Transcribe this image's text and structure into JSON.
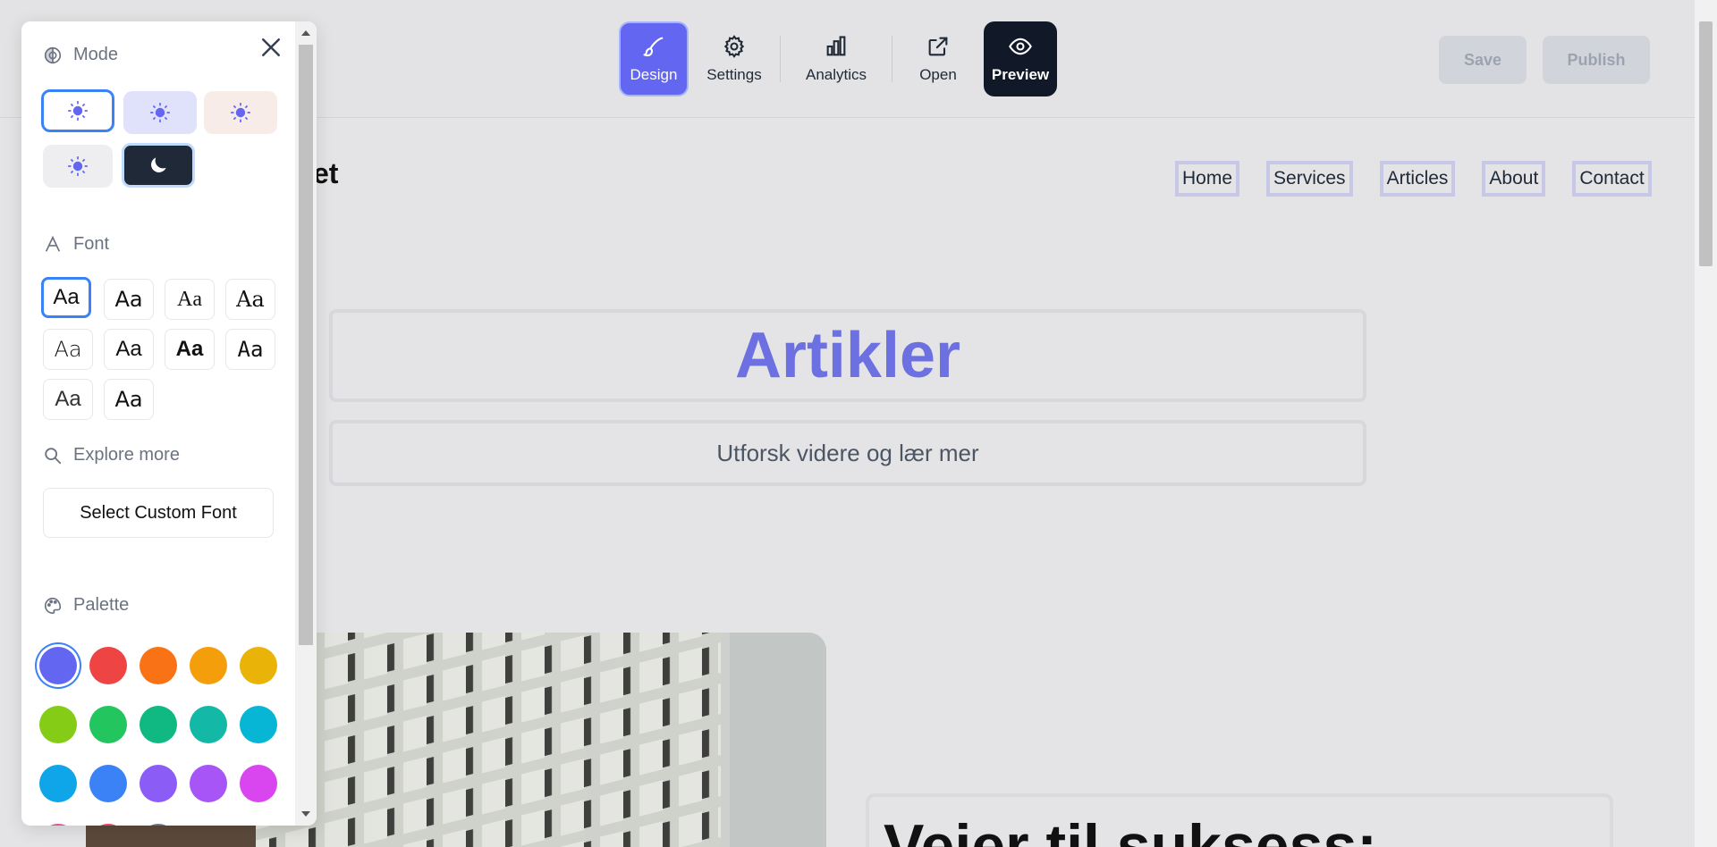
{
  "toolbar": {
    "design": "Design",
    "settings": "Settings",
    "analytics": "Analytics",
    "open": "Open",
    "preview": "Preview",
    "save": "Save",
    "publish": "Publish"
  },
  "site": {
    "logo_fragment": "et",
    "nav": [
      "Home",
      "Services",
      "Articles",
      "About",
      "Contact"
    ],
    "hero_title": "Artikler",
    "hero_subtitle": "Utforsk videre og lær mer",
    "article_title": "Veier til suksess:"
  },
  "panel": {
    "mode_label": "Mode",
    "font_label": "Font",
    "font_sample": "Aa",
    "explore_label": "Explore more",
    "custom_font_label": "Select Custom Font",
    "palette_label": "Palette"
  },
  "colors": {
    "accent": "#6366f1",
    "palette": [
      "#6366f1",
      "#ef4444",
      "#f97316",
      "#f59e0b",
      "#eab308",
      "#84cc16",
      "#22c55e",
      "#10b981",
      "#14b8a6",
      "#06b6d4",
      "#0ea5e9",
      "#3b82f6",
      "#8b5cf6",
      "#a855f7",
      "#d946ef",
      "#ec4899",
      "#f43f5e",
      "#64748b"
    ]
  }
}
